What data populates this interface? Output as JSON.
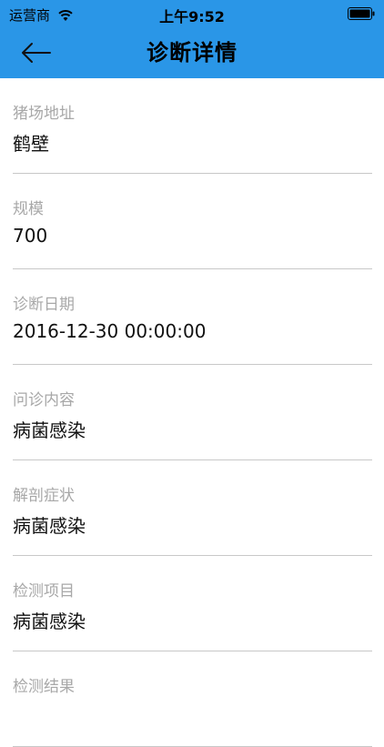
{
  "status_bar": {
    "carrier": "运营商",
    "time": "上午9:52",
    "icons": [
      "wifi-icon",
      "battery-icon"
    ]
  },
  "nav": {
    "title": "诊断详情",
    "back_icon": "arrow-left-icon"
  },
  "fields": [
    {
      "label": "猪场地址",
      "value": "鹤壁"
    },
    {
      "label": "规模",
      "value": "700"
    },
    {
      "label": "诊断日期",
      "value": "2016-12-30 00:00:00"
    },
    {
      "label": "问诊内容",
      "value": "病菌感染"
    },
    {
      "label": "解剖症状",
      "value": "病菌感染"
    },
    {
      "label": "检测项目",
      "value": "病菌感染"
    },
    {
      "label": "检测结果",
      "value": ""
    }
  ],
  "colors": {
    "header": "#2a96e7",
    "divider": "#c8c8c8",
    "label": "#a8a8a8"
  }
}
